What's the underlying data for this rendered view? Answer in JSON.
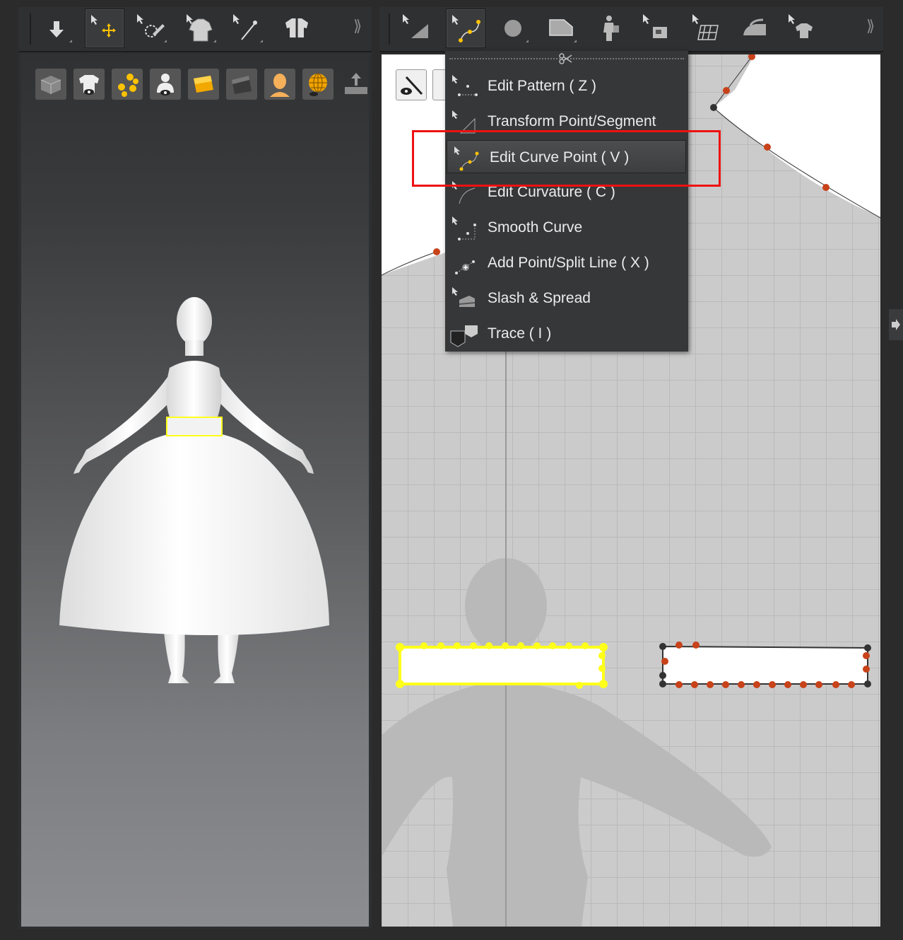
{
  "colors": {
    "accent": "#ffc200",
    "highlight_box": "#e11111",
    "selected_outline": "#ffff1a",
    "pattern_point": "#c8421a",
    "menu_bg": "#363738"
  },
  "left_toolbar": {
    "tools": [
      {
        "icon": "simulate-arrow-icon"
      },
      {
        "icon": "select-move-icon",
        "active": true
      },
      {
        "icon": "select-mesh-brush-icon"
      },
      {
        "icon": "fold-arrangement-icon"
      },
      {
        "icon": "edit-pin-icon"
      },
      {
        "icon": "show-garment-icon"
      }
    ],
    "more": "⟫"
  },
  "left_subtools": [
    {
      "icon": "show-3d-box-icon"
    },
    {
      "icon": "show-garment-eye-icon"
    },
    {
      "icon": "show-points-icon"
    },
    {
      "icon": "show-avatar-eye-icon"
    },
    {
      "icon": "texture-surface-icon"
    },
    {
      "icon": "mesh-surface-icon"
    },
    {
      "icon": "avatar-head-icon"
    },
    {
      "icon": "globe-eye-icon"
    },
    {
      "icon": "export-icon"
    }
  ],
  "right_toolbar": {
    "tools": [
      {
        "icon": "transform-pattern-icon"
      },
      {
        "icon": "edit-curve-point-icon",
        "active": true
      },
      {
        "icon": "circle-internal-icon"
      },
      {
        "icon": "rectangle-pattern-icon"
      },
      {
        "icon": "arrangement-avatar-icon"
      },
      {
        "icon": "sewing-icon"
      },
      {
        "icon": "grid-sewing-icon"
      },
      {
        "icon": "iron-icon"
      },
      {
        "icon": "garment-fit-icon"
      }
    ],
    "more": "⟫"
  },
  "menu": {
    "items": [
      {
        "label": "Edit Pattern ( Z )",
        "icon": "edit-pattern-icon"
      },
      {
        "label": "Transform Point/Segment",
        "icon": "transform-point-icon"
      },
      {
        "label": "Edit Curve Point ( V )",
        "icon": "edit-curve-point-icon",
        "highlighted": true
      },
      {
        "label": "Edit Curvature ( C )",
        "icon": "edit-curvature-icon"
      },
      {
        "label": "Smooth Curve",
        "icon": "smooth-curve-icon"
      },
      {
        "label": "Add Point/Split Line ( X )",
        "icon": "add-point-icon"
      },
      {
        "label": "Slash & Spread",
        "icon": "slash-spread-icon"
      },
      {
        "label": "Trace ( I )",
        "icon": "trace-icon"
      }
    ]
  }
}
